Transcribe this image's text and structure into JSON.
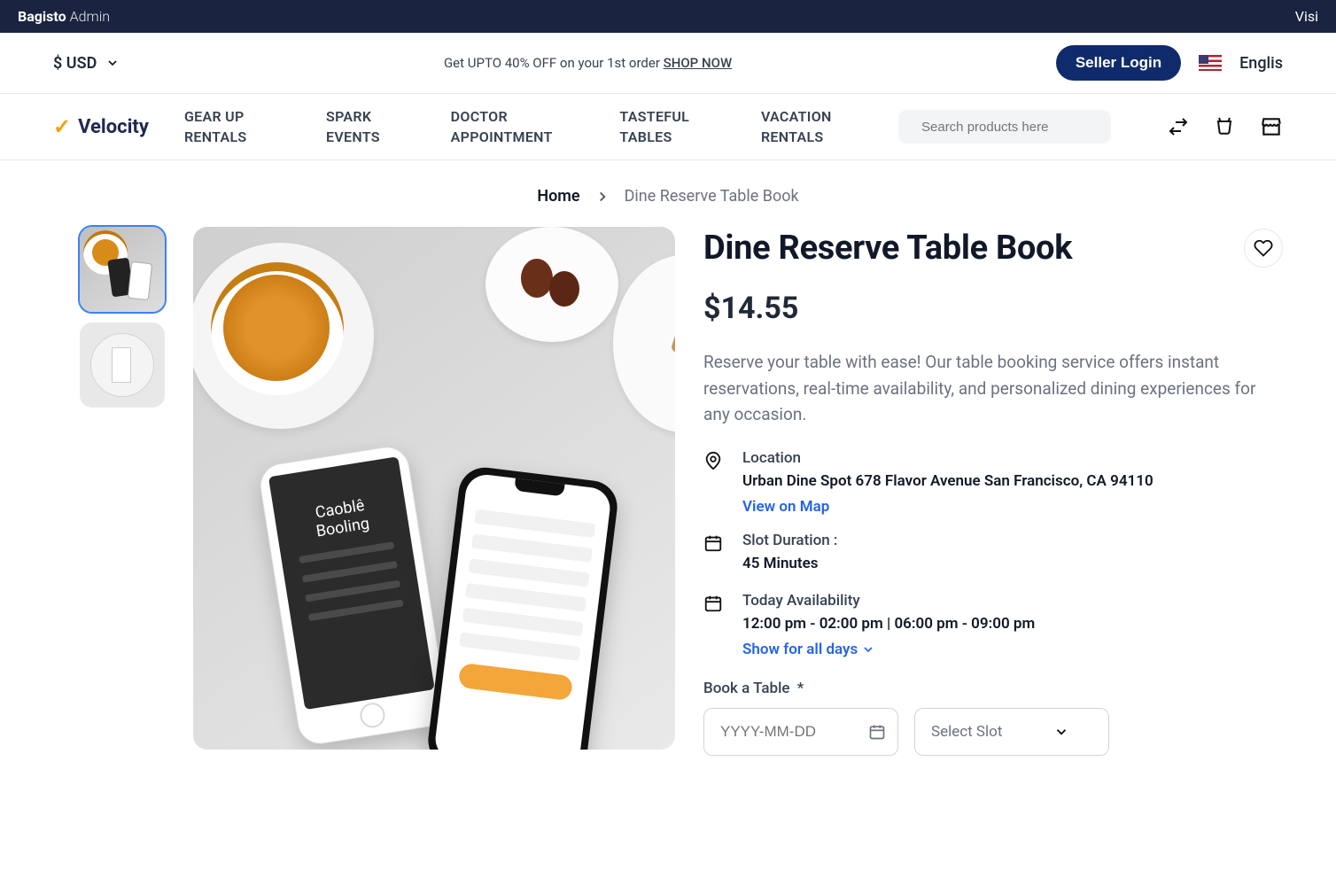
{
  "admin": {
    "brand": "Bagisto",
    "role": "Admin",
    "right": "Visi"
  },
  "topbar": {
    "currency": "$ USD",
    "promo_text": "Get UPTO 40% OFF on your 1st order ",
    "promo_link": "SHOP NOW",
    "seller_login": "Seller Login",
    "language": "Englis"
  },
  "logo": {
    "text": "Velocity"
  },
  "nav": [
    "GEAR UP RENTALS",
    "SPARK EVENTS",
    "DOCTOR APPOINTMENT",
    "TASTEFUL TABLES",
    "VACATION RENTALS"
  ],
  "search": {
    "placeholder": "Search products here"
  },
  "breadcrumb": {
    "home": "Home",
    "current": "Dine Reserve Table Book"
  },
  "product": {
    "title": "Dine Reserve Table Book",
    "price": "$14.55",
    "description": "Reserve your table with ease! Our table booking service offers instant reservations, real-time availability, and personalized dining experiences for any occasion.",
    "location": {
      "label": "Location",
      "value": "Urban Dine Spot 678 Flavor Avenue San Francisco, CA 94110",
      "link": "View on Map"
    },
    "slot": {
      "label": "Slot Duration :",
      "value": "45 Minutes"
    },
    "availability": {
      "label": "Today Availability",
      "value": "12:00 pm - 02:00 pm | 06:00 pm - 09:00 pm",
      "expand": "Show for all days"
    },
    "book_label": "Book a Table",
    "required": "*",
    "date_placeholder": "YYYY-MM-DD",
    "slot_placeholder": "Select Slot",
    "phone_overlay": "Caoblê Booling"
  }
}
